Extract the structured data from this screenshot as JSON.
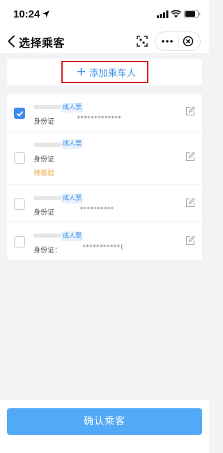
{
  "status_bar": {
    "time": "10:24",
    "icons": [
      "location-arrow-icon",
      "signal-icon",
      "wifi-icon",
      "battery-icon"
    ]
  },
  "nav": {
    "title": "选择乘客",
    "icons": [
      "back-icon",
      "scan-icon",
      "more-icon",
      "close-icon"
    ]
  },
  "add_passenger": {
    "label": "添加乘车人",
    "icon": "plus-icon"
  },
  "passengers": [
    {
      "checked": true,
      "ticket_type": "成人票",
      "id_label": "身份证",
      "id_value": "*************",
      "status": ""
    },
    {
      "checked": false,
      "ticket_type": "成人票",
      "id_label": "身份证",
      "id_value": "",
      "status": "待核验"
    },
    {
      "checked": false,
      "ticket_type": "成人票",
      "id_label": "身份证",
      "id_value": "**********",
      "status": ""
    },
    {
      "checked": false,
      "ticket_type": "成人票",
      "id_label": "身份证：",
      "id_value": "***********(",
      "status": ""
    }
  ],
  "footer": {
    "confirm_label": "确认乘客"
  },
  "colors": {
    "accent": "#3a8fe8",
    "confirm_button": "#52a9f6",
    "highlight_box": "#d6202b",
    "pending": "#e8a23a",
    "background": "#f3f3f5"
  }
}
